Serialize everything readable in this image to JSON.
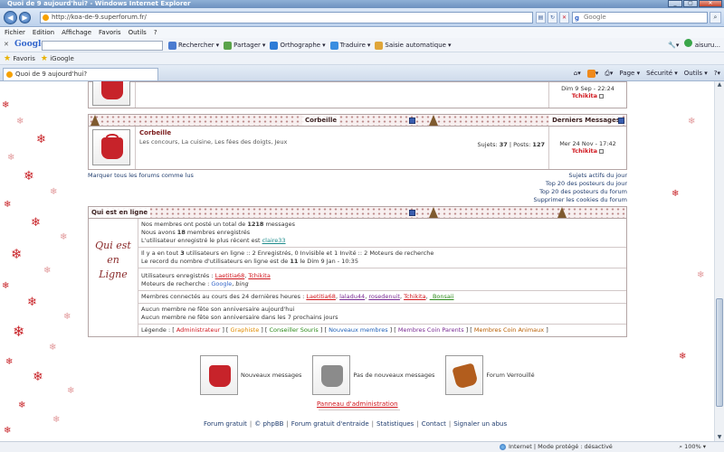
{
  "window": {
    "title": "Quoi de 9 aujourd'hui? - Windows Internet Explorer",
    "controls": [
      "_",
      "▢",
      "✕"
    ]
  },
  "address": {
    "url": "http://koa-de-9.superforum.fr/",
    "search_placeholder": "Google"
  },
  "menu": {
    "items": [
      "Fichier",
      "Edition",
      "Affichage",
      "Favoris",
      "Outils",
      "?"
    ]
  },
  "google_toolbar": {
    "logo": "Google",
    "items": [
      "Rechercher",
      "Partager",
      "Orthographe",
      "Traduire",
      "Saisie automatique"
    ],
    "right": [
      "aisuru..."
    ]
  },
  "favorites_bar": {
    "favoris": "Favoris",
    "igoogle": "iGoogle"
  },
  "tab": {
    "title": "Quoi de 9 aujourd'hui?"
  },
  "command_bar": {
    "items": [
      "Page",
      "Sécurité",
      "Outils"
    ]
  },
  "forum": {
    "top_row": {
      "lastpost_date": "Dim 9 Sep - 22:24",
      "lastpost_user": "Tchikita"
    },
    "category_bar": {
      "name": "Corbeille",
      "lastpost_header": "Derniers Messages"
    },
    "corbeille": {
      "title": "Corbeille",
      "description": "Les concours, La cuisine, Les fées des doigts, Jeux",
      "stats_sujets_label": "Sujets",
      "stats_sujets": "37",
      "stats_posts_label": "Posts",
      "stats_posts": "127",
      "lastpost_date": "Mer 24 Nov - 17:42",
      "lastpost_user": "Tchikita"
    },
    "mark_read": "Marquer tous les forums comme lus",
    "right_links": [
      "Sujets actifs du jour",
      "Top 20 des posteurs du jour",
      "Top 20 des posteurs du forum",
      "Supprimer les cookies du forum"
    ]
  },
  "who": {
    "title": "Qui est en ligne",
    "image_text": "Qui est en Ligne",
    "stats1_a": "Nos membres ont posté un total de ",
    "stats1_b": "1218",
    "stats1_c": " messages",
    "stats2_a": "Nous avons ",
    "stats2_b": "18",
    "stats2_c": " membres enregistrés",
    "stats3_a": "L'utilisateur enregistré le plus récent est ",
    "stats3_b": "claire33",
    "online1_a": "Il y a en tout ",
    "online1_b": "3",
    "online1_c": " utilisateurs en ligne :: 2 Enregistrés, 0 Invisible et 1 Invité :: 2 Moteurs de recherche",
    "online2_a": "Le record du nombre d'utilisateurs en ligne est de ",
    "online2_b": "11",
    "online2_c": " le Dim 9 Jan - 10:35",
    "registered_label": "Utilisateurs enregistrés : ",
    "registered_users": [
      "Laetitia68",
      "Tchikita"
    ],
    "bots_label": "Moteurs de recherche : ",
    "bot_google": "Google",
    "bot_bing": "bing",
    "last24_label": "Membres connectés au cours des 24 dernières heures : ",
    "last24_users": [
      "Laetitia68",
      "laladu44",
      "rosedenuit",
      "Tchikita",
      "_Bonsaii"
    ],
    "birthday1": "Aucun membre ne fête son anniversaire aujourd'hui",
    "birthday2": "Aucun membre ne fête son anniversaire dans les 7 prochains jours",
    "legend_label": "Légende : ",
    "legend": [
      "Administrateur",
      "Graphiste",
      "Conseiller Souris",
      "Nouveaux membres",
      "Membres Coin Parents",
      "Membres Coin Animaux"
    ]
  },
  "icons_legend": {
    "new": "Nouveaux messages",
    "nonew": "Pas de nouveaux messages",
    "locked": "Forum Verrouillé"
  },
  "admin_panel": "Panneau d'administration",
  "footer": [
    "Forum gratuit",
    "© phpBB",
    "Forum gratuit d'entraide",
    "Statistiques",
    "Contact",
    "Signaler un abus"
  ],
  "status": {
    "zone": "Internet | Mode protégé : désactivé",
    "zoom": "100%"
  }
}
